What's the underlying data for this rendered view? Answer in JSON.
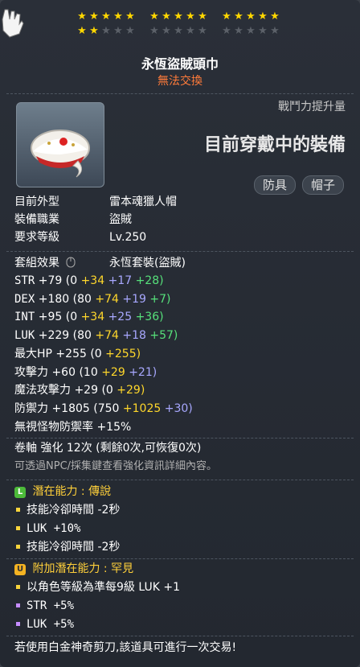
{
  "stars": {
    "row1": [
      1,
      1,
      1,
      1,
      1,
      1,
      1,
      1,
      1,
      1,
      1,
      1,
      1,
      1,
      1
    ],
    "row2": [
      1,
      1,
      0,
      0,
      0,
      0,
      0,
      0,
      0,
      0,
      0,
      0,
      0,
      0,
      0
    ]
  },
  "item": {
    "name": "永恆盜賊頭巾",
    "trade": "無法交換",
    "combat_power_label": "戰鬥力提升量",
    "equipped_label": "目前穿戴中的裝備",
    "tags": [
      "防具",
      "帽子"
    ]
  },
  "info": [
    {
      "label": "目前外型",
      "value": "雷本魂獵人帽"
    },
    {
      "label": "裝備職業",
      "value": "盜賊"
    },
    {
      "label": "要求等級",
      "value": "Lv.250"
    }
  ],
  "set": {
    "label": "套組效果",
    "value": "永恆套裝(盜賊)"
  },
  "stats": [
    {
      "name": "STR",
      "total": "+79",
      "open": "(0",
      "p1": "+34",
      "p2": "+17",
      "p3": "+28)"
    },
    {
      "name": "DEX",
      "total": "+180",
      "open": "(80",
      "p1": "+74",
      "p2": "+19",
      "p3": "+7)"
    },
    {
      "name": "INT",
      "total": "+95",
      "open": "(0",
      "p1": "+34",
      "p2": "+25",
      "p3": "+36)"
    },
    {
      "name": "LUK",
      "total": "+229",
      "open": "(80",
      "p1": "+74",
      "p2": "+18",
      "p3": "+57)"
    },
    {
      "name": "最大HP",
      "total": "+255",
      "open": "(0",
      "p1": "+255)",
      "p2": "",
      "p3": ""
    },
    {
      "name": "攻擊力",
      "total": "+60",
      "open": "(10",
      "p1": "+29",
      "p2": "+21)",
      "p3": ""
    },
    {
      "name": "魔法攻擊力",
      "total": "+29",
      "open": "(0",
      "p1": "+29)",
      "p2": "",
      "p3": ""
    },
    {
      "name": "防禦力",
      "total": "+1805",
      "open": "(750",
      "p1": "+1025",
      "p2": "+30)",
      "p3": ""
    },
    {
      "name": "無視怪物防禦率",
      "total": "+15%",
      "open": "",
      "p1": "",
      "p2": "",
      "p3": ""
    }
  ],
  "scroll": {
    "text": "卷軸 強化 12次 (剩餘0次,可恢復0次)",
    "hint": "可透過NPC/採集鍵查看強化資訊詳細內容。"
  },
  "potential": {
    "badge": "L",
    "title": "潛在能力 : 傳說",
    "lines": [
      "技能冷卻時間 -2秒",
      "LUK +10%",
      "技能冷卻時間 -2秒"
    ]
  },
  "additional": {
    "badge": "U",
    "title": "附加潛在能力 : 罕見",
    "lines": [
      "以角色等級為準每9級 LUK +1",
      "STR +5%",
      "LUK +5%"
    ]
  },
  "footer": "若使用白金神奇剪刀,該道具可進行一次交易!",
  "colors": {
    "gold": "#ffd72b",
    "purple": "#a8a8ff",
    "green": "#56e07a",
    "orange": "#ff7b3a"
  }
}
